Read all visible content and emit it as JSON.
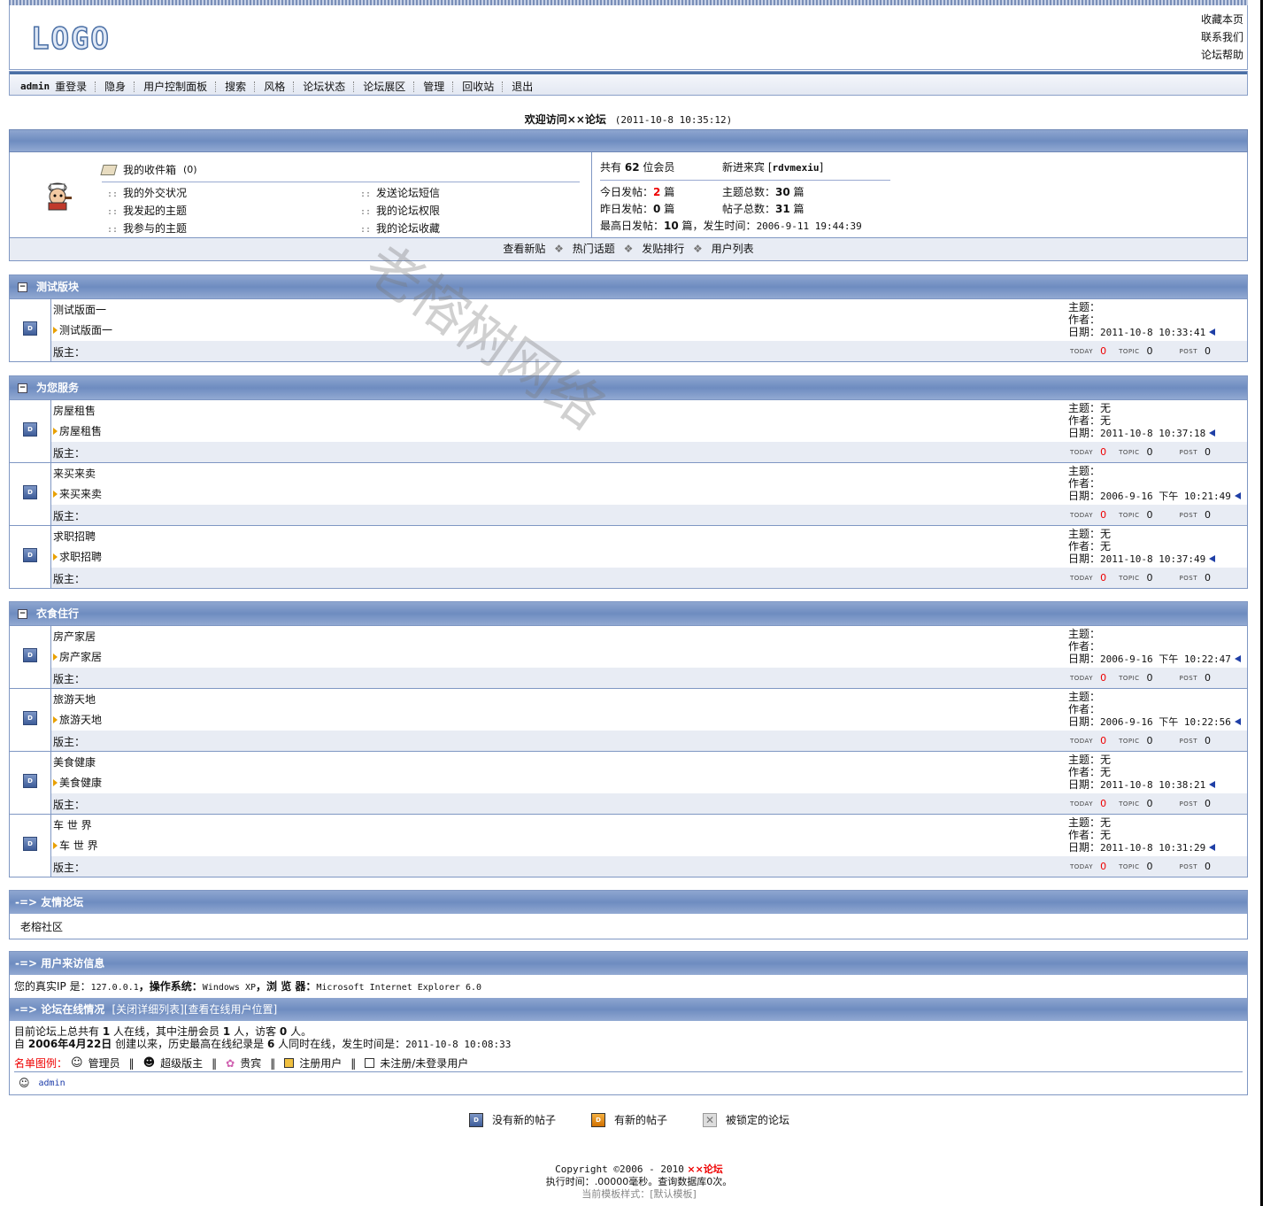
{
  "header": {
    "logo_text": "LOGO",
    "toplinks": [
      "收藏本页",
      "联系我们",
      "论坛帮助"
    ]
  },
  "menu": {
    "user": "admin",
    "items": [
      "重登录",
      "隐身",
      "用户控制面板",
      "搜索",
      "风格",
      "论坛状态",
      "论坛展区",
      "管理",
      "回收站",
      "退出"
    ]
  },
  "welcome": {
    "title": "欢迎访问××论坛",
    "time": "(2011-10-8 10:35:12)"
  },
  "userbox": {
    "inbox_label": "我的收件箱",
    "inbox_count": "(0)",
    "links_left": [
      "我的外交状况",
      "我发起的主题",
      "我参与的主题"
    ],
    "links_right": [
      "发送论坛短信",
      "我的论坛权限",
      "我的论坛收藏"
    ],
    "prefix": "::"
  },
  "stats": {
    "members_pre": "共有",
    "members": "62",
    "members_post": "位会员",
    "newest_pre": "新进来宾 [",
    "newest": "rdvmexiu",
    "newest_post": "]",
    "today_label": "今日发帖：",
    "today": "2",
    "unit": "篇",
    "yesterday_label": "昨日发帖：",
    "yesterday": "0",
    "topics_label": "主题总数：",
    "topics": "30",
    "posts_label": "帖子总数：",
    "posts": "31",
    "max_label": "最高日发帖：",
    "max": "10",
    "max_post": "篇，发生时间：",
    "max_time": "2006-9-11 19:44:39"
  },
  "quicklinks": [
    "查看新贴",
    "热门话题",
    "发贴排行",
    "用户列表"
  ],
  "labels": {
    "topic": "主题：",
    "author": "作者：",
    "date": "日期：",
    "moderator": "版主：",
    "today": "TODAY",
    "topic_en": "TOPIC",
    "post": "POST",
    "none": "无"
  },
  "categories": [
    {
      "title": "测试版块",
      "forums": [
        {
          "name": "测试版面一",
          "sub": "测试版面一",
          "topic": "",
          "author": "",
          "date": "2011-10-8 10:33:41",
          "today": "0",
          "topics": "0",
          "posts": "0"
        }
      ]
    },
    {
      "title": "为您服务",
      "forums": [
        {
          "name": "房屋租售",
          "sub": "房屋租售",
          "topic": "无",
          "author": "无",
          "date": "2011-10-8 10:37:18",
          "today": "0",
          "topics": "0",
          "posts": "0"
        },
        {
          "name": "来买来卖",
          "sub": "来买来卖",
          "topic": "",
          "author": "",
          "date": "2006-9-16 下午 10:21:49",
          "today": "0",
          "topics": "0",
          "posts": "0"
        },
        {
          "name": "求职招聘",
          "sub": "求职招聘",
          "topic": "无",
          "author": "无",
          "date": "2011-10-8 10:37:49",
          "today": "0",
          "topics": "0",
          "posts": "0"
        }
      ]
    },
    {
      "title": "衣食住行",
      "forums": [
        {
          "name": "房产家居",
          "sub": "房产家居",
          "topic": "",
          "author": "",
          "date": "2006-9-16 下午 10:22:47",
          "today": "0",
          "topics": "0",
          "posts": "0"
        },
        {
          "name": "旅游天地",
          "sub": "旅游天地",
          "topic": "",
          "author": "",
          "date": "2006-9-16 下午 10:22:56",
          "today": "0",
          "topics": "0",
          "posts": "0"
        },
        {
          "name": "美食健康",
          "sub": "美食健康",
          "topic": "无",
          "author": "无",
          "date": "2011-10-8 10:38:21",
          "today": "0",
          "topics": "0",
          "posts": "0"
        },
        {
          "name": "车 世 界",
          "sub": "车 世 界",
          "topic": "无",
          "author": "无",
          "date": "2011-10-8 10:31:29",
          "today": "0",
          "topics": "0",
          "posts": "0"
        }
      ]
    }
  ],
  "friends": {
    "title": "-=> 友情论坛",
    "items": [
      "老榕社区"
    ]
  },
  "visitor": {
    "title": "-=> 用户来访信息",
    "ip_label": "您的真实IP 是：",
    "ip": "127.0.0.1",
    "os_label": "，操作系统：",
    "os": "Windows XP",
    "browser_label": "，浏 览 器：",
    "browser": "Microsoft Internet Explorer 6.0"
  },
  "online": {
    "title": "-=> 论坛在线情况",
    "link1": "[关闭详细列表]",
    "link2": "[查看在线用户位置]",
    "line1_a": "目前论坛上总共有",
    "total": "1",
    "line1_b": "人在线，其中注册会员",
    "members": "1",
    "line1_c": "人，访客",
    "guests": "0",
    "line1_d": "人。",
    "line2_a": "自",
    "created": "2006年4月22日",
    "line2_b": "创建以来，历史最高在线纪录是",
    "record": "6",
    "line2_c": "人同时在线，发生时间是：",
    "record_time": "2011-10-8 10:08:33",
    "legend_label": "名单图例：",
    "legend": [
      "管理员",
      "超级版主",
      "贵宾",
      "注册用户",
      "未注册/未登录用户"
    ],
    "users": [
      "admin"
    ]
  },
  "icon_legend": [
    "没有新的帖子",
    "有新的帖子",
    "被锁定的论坛"
  ],
  "footer": {
    "copyright": "Copyright ©2006 - 2010",
    "brand": "××论坛",
    "exec": "执行时间：.00000毫秒。查询数据库0次。",
    "template": "当前模板样式：[默认模板]"
  },
  "watermark": "老榕树网络",
  "colors": {
    "accent": "#6e8cc0",
    "border": "#7f97c3",
    "highlight": "#e00000"
  }
}
